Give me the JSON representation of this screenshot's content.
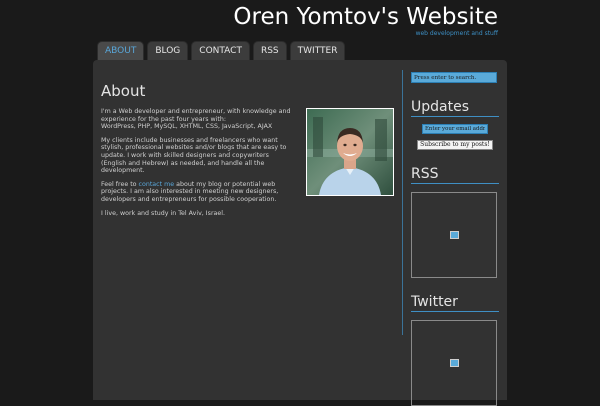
{
  "header": {
    "title": "Oren Yomtov's Website",
    "tagline": "web development and stuff"
  },
  "nav": {
    "tabs": [
      {
        "label": "ABOUT",
        "active": true
      },
      {
        "label": "BLOG",
        "active": false
      },
      {
        "label": "CONTACT",
        "active": false
      },
      {
        "label": "RSS",
        "active": false
      },
      {
        "label": "TWITTER",
        "active": false
      }
    ]
  },
  "main": {
    "heading": "About",
    "paragraphs": {
      "p1": "I'm a Web developer and entrepreneur, with knowledge and experience for the past four years with:",
      "p1_skills": "WordPress, PHP, MySQL, XHTML, CSS, JavaScript, AJAX",
      "p2": "My clients include businesses and freelancers who want stylish, professional websites and/or blogs that are easy to update. I work with skilled designers and copywriters (English and Hebrew) as needed, and handle all the development.",
      "p3_before": "Feel free to ",
      "p3_link": "contact me",
      "p3_after": " about my blog or potential web projects. I am also interested in meeting new designers, developers and entrepreneurs for possible cooperation.",
      "p4": "I live, work and study in Tel Aviv, Israel."
    },
    "photo_icon": "portrait-photo"
  },
  "sidebar": {
    "search_value": "Press enter to search.",
    "updates_heading": "Updates",
    "email_value": "Enter your email addre",
    "subscribe_label": "Subscribe to my posts!",
    "rss_heading": "RSS",
    "twitter_heading": "Twitter",
    "broken_image_icon": "broken-image-icon"
  },
  "colors": {
    "background": "#1a1a1a",
    "panel": "#323232",
    "accent": "#59a6d8",
    "input_bg": "#5aaad9"
  }
}
